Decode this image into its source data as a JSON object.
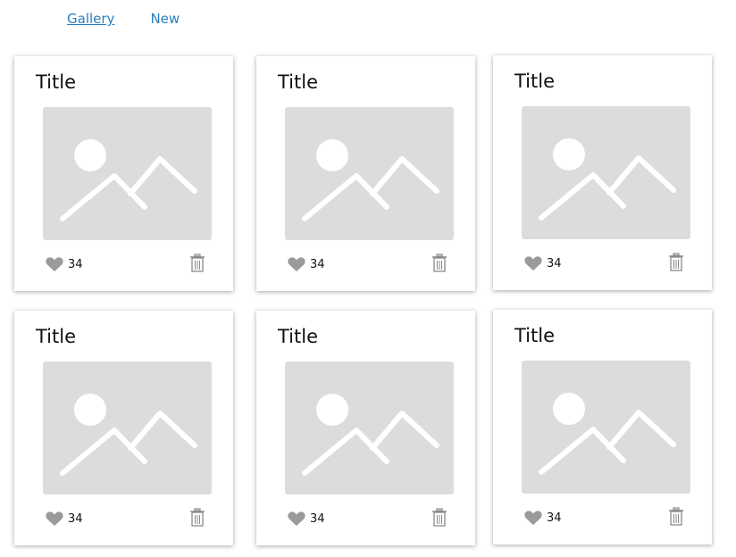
{
  "nav": {
    "items": [
      {
        "label": "Gallery",
        "active": true
      },
      {
        "label": "New",
        "active": false
      }
    ]
  },
  "cards": [
    {
      "title": "Title",
      "likes": "34"
    },
    {
      "title": "Title",
      "likes": "34"
    },
    {
      "title": "Title",
      "likes": "34"
    },
    {
      "title": "Title",
      "likes": "34"
    },
    {
      "title": "Title",
      "likes": "34"
    },
    {
      "title": "Title",
      "likes": "34"
    }
  ],
  "icons": {
    "like": "heart-icon",
    "delete": "trash-icon",
    "placeholder": "image-placeholder-icon"
  },
  "colors": {
    "link": "#2a7fc1",
    "placeholder_bg": "#dcdcdc",
    "icon_gray": "#9a9a9a"
  }
}
